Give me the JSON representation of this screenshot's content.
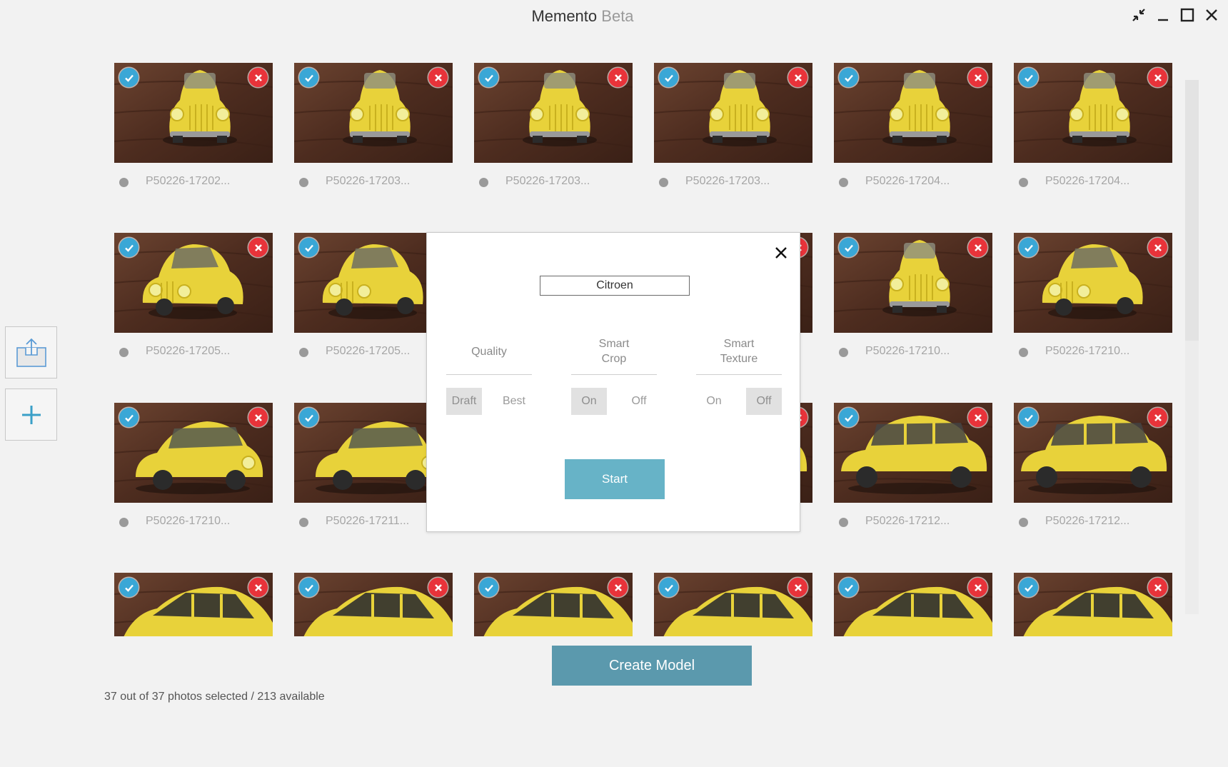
{
  "app": {
    "title": "Memento",
    "badge": "Beta"
  },
  "window_controls": [
    "restore-icon",
    "minimize-icon",
    "maximize-icon",
    "close-icon"
  ],
  "sidebar": {
    "tools": [
      {
        "icon": "upload-icon"
      },
      {
        "icon": "plus-icon"
      }
    ]
  },
  "colors": {
    "accent": "#67b3c7",
    "create_button": "#5b99ad",
    "check": "#3aa7d6",
    "remove": "#e8333a"
  },
  "photos": [
    {
      "name": "P50226-17202...",
      "view": "front"
    },
    {
      "name": "P50226-17203...",
      "view": "front"
    },
    {
      "name": "P50226-17203...",
      "view": "front"
    },
    {
      "name": "P50226-17203...",
      "view": "front"
    },
    {
      "name": "P50226-17204...",
      "view": "front"
    },
    {
      "name": "P50226-17204...",
      "view": "front"
    },
    {
      "name": "P50226-17205...",
      "view": "front-left"
    },
    {
      "name": "P50226-17205...",
      "view": "front-left"
    },
    {
      "name": "",
      "view": "front-left"
    },
    {
      "name": "",
      "view": "front-left"
    },
    {
      "name": "P50226-17210...",
      "view": "front"
    },
    {
      "name": "P50226-17210...",
      "view": "front-left"
    },
    {
      "name": "P50226-17210...",
      "view": "side-right"
    },
    {
      "name": "P50226-17211...",
      "view": "side-right"
    },
    {
      "name": "",
      "view": "side-left"
    },
    {
      "name": "",
      "view": "side-left"
    },
    {
      "name": "P50226-17212...",
      "view": "side-left"
    },
    {
      "name": "P50226-17212...",
      "view": "side-left"
    },
    {
      "name": "",
      "view": "rear-side"
    },
    {
      "name": "",
      "view": "rear-side"
    },
    {
      "name": "",
      "view": "rear-side"
    },
    {
      "name": "",
      "view": "rear-side"
    },
    {
      "name": "",
      "view": "rear-side"
    },
    {
      "name": "",
      "view": "rear-side"
    }
  ],
  "dialog": {
    "model_name": "Citroen",
    "options": [
      {
        "title": "Quality",
        "choices": [
          "Draft",
          "Best"
        ],
        "selected": "Draft"
      },
      {
        "title": "Smart\nCrop",
        "choices": [
          "On",
          "Off"
        ],
        "selected": "On"
      },
      {
        "title": "Smart\nTexture",
        "choices": [
          "On",
          "Off"
        ],
        "selected": "Off"
      }
    ],
    "start_label": "Start"
  },
  "create_label": "Create Model",
  "status": "37 out of 37 photos selected / 213 available"
}
